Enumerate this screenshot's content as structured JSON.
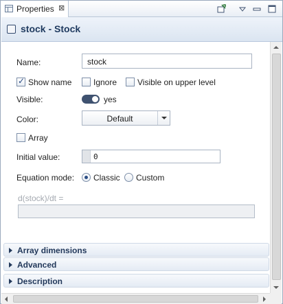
{
  "tab": {
    "title": "Properties",
    "close_glyph": "⊠"
  },
  "toolbar": {
    "icons": [
      "pin-to-view-icon",
      "view-menu-icon",
      "minimize-icon",
      "maximize-icon"
    ]
  },
  "header": {
    "title": "stock - Stock"
  },
  "form": {
    "name_label": "Name:",
    "name_value": "stock",
    "show_name_label": "Show name",
    "show_name_checked": true,
    "ignore_label": "Ignore",
    "ignore_checked": false,
    "visible_upper_label": "Visible on upper level",
    "visible_upper_checked": false,
    "visible_label": "Visible:",
    "visible_value": "yes",
    "color_label": "Color:",
    "color_value": "Default",
    "array_label": "Array",
    "array_checked": false,
    "initial_value_label": "Initial value:",
    "initial_value": "0",
    "equation_mode_label": "Equation mode:",
    "mode_classic": "Classic",
    "mode_custom": "Custom",
    "mode_selected": "Classic",
    "equation_label": "d(stock)/dt =",
    "equation_value": ""
  },
  "sections": [
    {
      "label": "Array dimensions"
    },
    {
      "label": "Advanced"
    },
    {
      "label": "Description"
    }
  ],
  "colors": {
    "header_title": "#1f3a5f",
    "section_text": "#23395b",
    "toggle_on": "#3f5270"
  }
}
